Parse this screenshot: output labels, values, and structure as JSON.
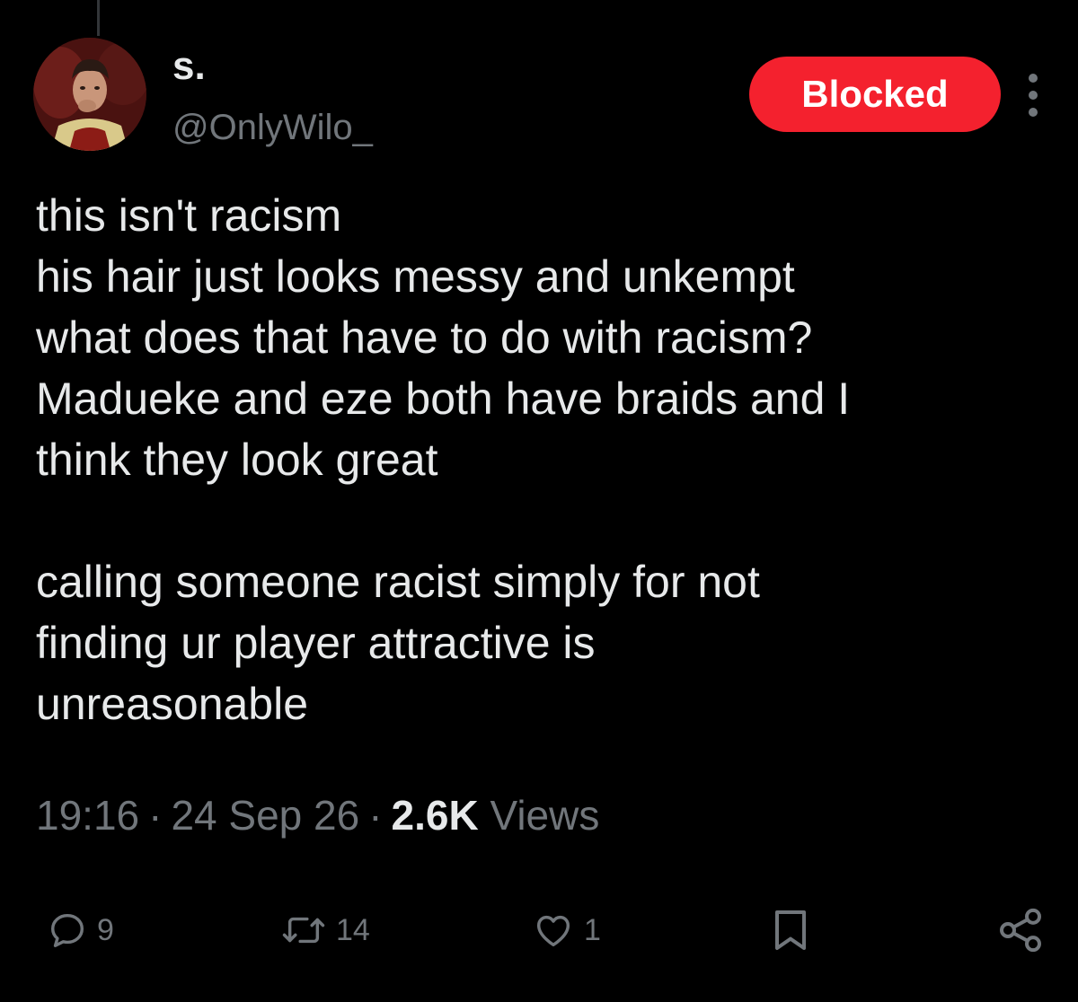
{
  "tweet": {
    "author": {
      "display_name": "s.",
      "handle": "@OnlyWilo_"
    },
    "status_button": {
      "label": "Blocked",
      "color": "#f4212e"
    },
    "more_icon": "more-vertical-icon",
    "body_lines": [
      "this isn't racism",
      "his hair just looks messy and unkempt",
      "what does that have to do with racism?",
      "Madueke and eze both have braids and I",
      "think they look great",
      "",
      "calling someone racist simply for not",
      "finding ur player attractive is",
      "unreasonable"
    ],
    "meta": {
      "time": "19:16",
      "separator": "·",
      "date": "24 Sep 26",
      "views_count": "2.6K",
      "views_label": "Views"
    },
    "actions": {
      "reply": {
        "icon": "reply-icon",
        "count": "9"
      },
      "repost": {
        "icon": "repost-icon",
        "count": "14"
      },
      "like": {
        "icon": "heart-icon",
        "count": "1"
      },
      "bookmark": {
        "icon": "bookmark-icon"
      },
      "share": {
        "icon": "share-icon"
      }
    }
  },
  "colors": {
    "background": "#000000",
    "primary_text": "#e7e9ea",
    "secondary_text": "#71767b"
  }
}
